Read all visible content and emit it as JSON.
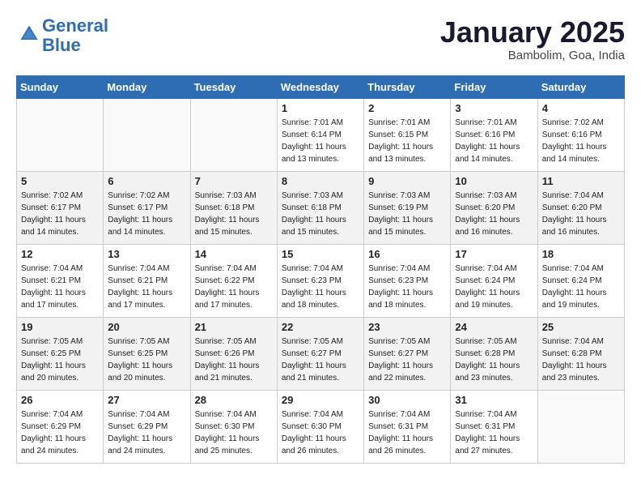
{
  "header": {
    "logo_line1": "General",
    "logo_line2": "Blue",
    "month": "January 2025",
    "location": "Bambolim, Goa, India"
  },
  "weekdays": [
    "Sunday",
    "Monday",
    "Tuesday",
    "Wednesday",
    "Thursday",
    "Friday",
    "Saturday"
  ],
  "weeks": [
    [
      {
        "day": "",
        "sunrise": "",
        "sunset": "",
        "daylight": ""
      },
      {
        "day": "",
        "sunrise": "",
        "sunset": "",
        "daylight": ""
      },
      {
        "day": "",
        "sunrise": "",
        "sunset": "",
        "daylight": ""
      },
      {
        "day": "1",
        "sunrise": "Sunrise: 7:01 AM",
        "sunset": "Sunset: 6:14 PM",
        "daylight": "Daylight: 11 hours and 13 minutes."
      },
      {
        "day": "2",
        "sunrise": "Sunrise: 7:01 AM",
        "sunset": "Sunset: 6:15 PM",
        "daylight": "Daylight: 11 hours and 13 minutes."
      },
      {
        "day": "3",
        "sunrise": "Sunrise: 7:01 AM",
        "sunset": "Sunset: 6:16 PM",
        "daylight": "Daylight: 11 hours and 14 minutes."
      },
      {
        "day": "4",
        "sunrise": "Sunrise: 7:02 AM",
        "sunset": "Sunset: 6:16 PM",
        "daylight": "Daylight: 11 hours and 14 minutes."
      }
    ],
    [
      {
        "day": "5",
        "sunrise": "Sunrise: 7:02 AM",
        "sunset": "Sunset: 6:17 PM",
        "daylight": "Daylight: 11 hours and 14 minutes."
      },
      {
        "day": "6",
        "sunrise": "Sunrise: 7:02 AM",
        "sunset": "Sunset: 6:17 PM",
        "daylight": "Daylight: 11 hours and 14 minutes."
      },
      {
        "day": "7",
        "sunrise": "Sunrise: 7:03 AM",
        "sunset": "Sunset: 6:18 PM",
        "daylight": "Daylight: 11 hours and 15 minutes."
      },
      {
        "day": "8",
        "sunrise": "Sunrise: 7:03 AM",
        "sunset": "Sunset: 6:18 PM",
        "daylight": "Daylight: 11 hours and 15 minutes."
      },
      {
        "day": "9",
        "sunrise": "Sunrise: 7:03 AM",
        "sunset": "Sunset: 6:19 PM",
        "daylight": "Daylight: 11 hours and 15 minutes."
      },
      {
        "day": "10",
        "sunrise": "Sunrise: 7:03 AM",
        "sunset": "Sunset: 6:20 PM",
        "daylight": "Daylight: 11 hours and 16 minutes."
      },
      {
        "day": "11",
        "sunrise": "Sunrise: 7:04 AM",
        "sunset": "Sunset: 6:20 PM",
        "daylight": "Daylight: 11 hours and 16 minutes."
      }
    ],
    [
      {
        "day": "12",
        "sunrise": "Sunrise: 7:04 AM",
        "sunset": "Sunset: 6:21 PM",
        "daylight": "Daylight: 11 hours and 17 minutes."
      },
      {
        "day": "13",
        "sunrise": "Sunrise: 7:04 AM",
        "sunset": "Sunset: 6:21 PM",
        "daylight": "Daylight: 11 hours and 17 minutes."
      },
      {
        "day": "14",
        "sunrise": "Sunrise: 7:04 AM",
        "sunset": "Sunset: 6:22 PM",
        "daylight": "Daylight: 11 hours and 17 minutes."
      },
      {
        "day": "15",
        "sunrise": "Sunrise: 7:04 AM",
        "sunset": "Sunset: 6:23 PM",
        "daylight": "Daylight: 11 hours and 18 minutes."
      },
      {
        "day": "16",
        "sunrise": "Sunrise: 7:04 AM",
        "sunset": "Sunset: 6:23 PM",
        "daylight": "Daylight: 11 hours and 18 minutes."
      },
      {
        "day": "17",
        "sunrise": "Sunrise: 7:04 AM",
        "sunset": "Sunset: 6:24 PM",
        "daylight": "Daylight: 11 hours and 19 minutes."
      },
      {
        "day": "18",
        "sunrise": "Sunrise: 7:04 AM",
        "sunset": "Sunset: 6:24 PM",
        "daylight": "Daylight: 11 hours and 19 minutes."
      }
    ],
    [
      {
        "day": "19",
        "sunrise": "Sunrise: 7:05 AM",
        "sunset": "Sunset: 6:25 PM",
        "daylight": "Daylight: 11 hours and 20 minutes."
      },
      {
        "day": "20",
        "sunrise": "Sunrise: 7:05 AM",
        "sunset": "Sunset: 6:25 PM",
        "daylight": "Daylight: 11 hours and 20 minutes."
      },
      {
        "day": "21",
        "sunrise": "Sunrise: 7:05 AM",
        "sunset": "Sunset: 6:26 PM",
        "daylight": "Daylight: 11 hours and 21 minutes."
      },
      {
        "day": "22",
        "sunrise": "Sunrise: 7:05 AM",
        "sunset": "Sunset: 6:27 PM",
        "daylight": "Daylight: 11 hours and 21 minutes."
      },
      {
        "day": "23",
        "sunrise": "Sunrise: 7:05 AM",
        "sunset": "Sunset: 6:27 PM",
        "daylight": "Daylight: 11 hours and 22 minutes."
      },
      {
        "day": "24",
        "sunrise": "Sunrise: 7:05 AM",
        "sunset": "Sunset: 6:28 PM",
        "daylight": "Daylight: 11 hours and 23 minutes."
      },
      {
        "day": "25",
        "sunrise": "Sunrise: 7:04 AM",
        "sunset": "Sunset: 6:28 PM",
        "daylight": "Daylight: 11 hours and 23 minutes."
      }
    ],
    [
      {
        "day": "26",
        "sunrise": "Sunrise: 7:04 AM",
        "sunset": "Sunset: 6:29 PM",
        "daylight": "Daylight: 11 hours and 24 minutes."
      },
      {
        "day": "27",
        "sunrise": "Sunrise: 7:04 AM",
        "sunset": "Sunset: 6:29 PM",
        "daylight": "Daylight: 11 hours and 24 minutes."
      },
      {
        "day": "28",
        "sunrise": "Sunrise: 7:04 AM",
        "sunset": "Sunset: 6:30 PM",
        "daylight": "Daylight: 11 hours and 25 minutes."
      },
      {
        "day": "29",
        "sunrise": "Sunrise: 7:04 AM",
        "sunset": "Sunset: 6:30 PM",
        "daylight": "Daylight: 11 hours and 26 minutes."
      },
      {
        "day": "30",
        "sunrise": "Sunrise: 7:04 AM",
        "sunset": "Sunset: 6:31 PM",
        "daylight": "Daylight: 11 hours and 26 minutes."
      },
      {
        "day": "31",
        "sunrise": "Sunrise: 7:04 AM",
        "sunset": "Sunset: 6:31 PM",
        "daylight": "Daylight: 11 hours and 27 minutes."
      },
      {
        "day": "",
        "sunrise": "",
        "sunset": "",
        "daylight": ""
      }
    ]
  ]
}
